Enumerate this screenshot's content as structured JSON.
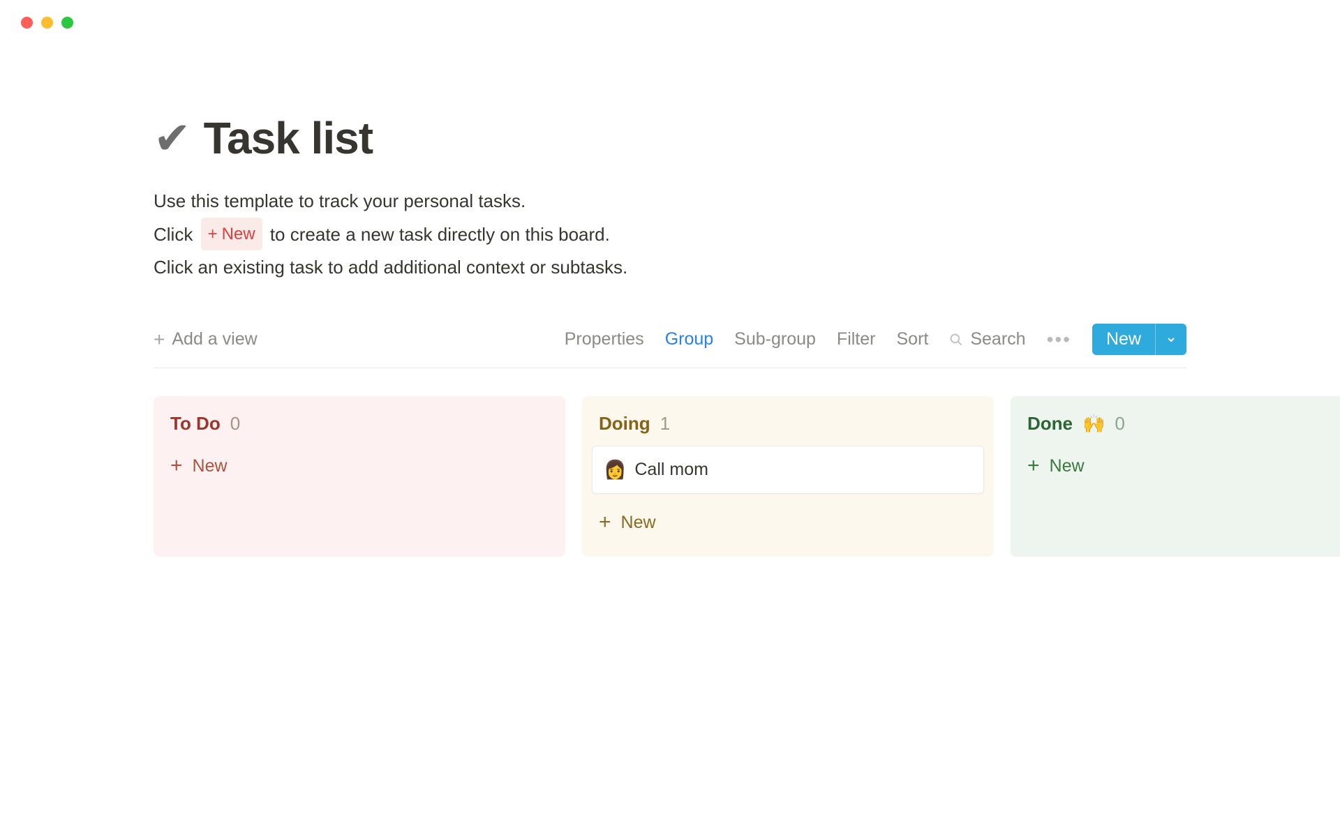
{
  "window": {
    "dots": [
      "red",
      "yellow",
      "green"
    ]
  },
  "page": {
    "icon": "✔",
    "title": "Task list",
    "description_line1": "Use this template to track your personal tasks.",
    "description_line2_prefix": "Click ",
    "description_new_button": "New",
    "description_line2_suffix": " to create a new task directly on this board.",
    "description_line3": "Click an existing task to add additional context or subtasks."
  },
  "toolbar": {
    "add_view": "Add a view",
    "properties": "Properties",
    "group": "Group",
    "sub_group": "Sub-group",
    "filter": "Filter",
    "sort": "Sort",
    "search": "Search",
    "new_button": "New"
  },
  "board": {
    "columns": [
      {
        "id": "todo",
        "title": "To Do",
        "count": "0",
        "cards": [],
        "new_label": "New"
      },
      {
        "id": "doing",
        "title": "Doing",
        "count": "1",
        "cards": [
          {
            "emoji": "👩",
            "title": "Call mom"
          }
        ],
        "new_label": "New"
      },
      {
        "id": "done",
        "title": "Done",
        "title_emoji": "🙌",
        "count": "0",
        "cards": [],
        "new_label": "New"
      }
    ]
  }
}
